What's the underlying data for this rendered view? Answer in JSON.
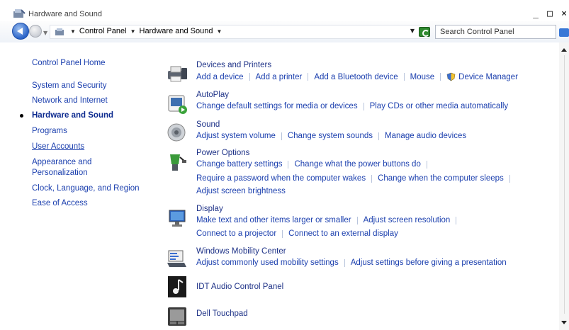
{
  "window": {
    "title": "Hardware and Sound",
    "minimize_glyph": "_",
    "maximize_glyph": "□",
    "close_glyph": "×"
  },
  "address": {
    "crumbs": [
      "Control Panel",
      "Hardware and Sound"
    ],
    "search_placeholder": "Search Control Panel"
  },
  "leftnav": {
    "items": [
      {
        "label": "Control Panel Home"
      },
      {
        "label": "System and Security"
      },
      {
        "label": "Network and Internet"
      },
      {
        "label": "Hardware and Sound",
        "current": true
      },
      {
        "label": "Programs"
      },
      {
        "label": "User Accounts",
        "underlined": true
      },
      {
        "label": "Appearance and"
      },
      {
        "label": "Personalization"
      },
      {
        "label": "Clock, Language, and Region"
      },
      {
        "label": "Ease of Access"
      }
    ]
  },
  "groups": [
    {
      "title": "Devices and Printers",
      "icon": "printer-icon",
      "lines": [
        [
          "Add a device",
          "Add a printer",
          "Add a Bluetooth device",
          "Mouse",
          "Device Manager"
        ]
      ]
    },
    {
      "title": "AutoPlay",
      "icon": "autoplay-icon",
      "lines": [
        [
          "Change default settings for media or devices",
          "Play CDs or other media automatically"
        ]
      ]
    },
    {
      "title": "Sound",
      "icon": "speaker-icon",
      "lines": [
        [
          "Adjust system volume",
          "Change system sounds",
          "Manage audio devices"
        ]
      ]
    },
    {
      "title": "Power Options",
      "icon": "power-options-icon",
      "lines": [
        [
          "Change battery settings",
          "Change what the power buttons do"
        ],
        [
          "Require a password when the computer wakes",
          "Change when the computer sleeps"
        ],
        [
          "Adjust screen brightness"
        ]
      ]
    },
    {
      "title": "Display",
      "icon": "display-icon",
      "lines": [
        [
          "Make text and other items larger or smaller",
          "Adjust screen resolution"
        ],
        [
          "Connect to a projector",
          "Connect to an external display"
        ]
      ]
    },
    {
      "title": "Windows Mobility Center",
      "icon": "mobility-center-icon",
      "lines": [
        [
          "Adjust commonly used mobility settings",
          "Adjust settings before giving a presentation"
        ]
      ]
    },
    {
      "title": "IDT Audio Control Panel",
      "icon": "music-note-icon",
      "lines": []
    },
    {
      "title": "Dell Touchpad",
      "icon": "touchpad-icon",
      "lines": []
    }
  ]
}
